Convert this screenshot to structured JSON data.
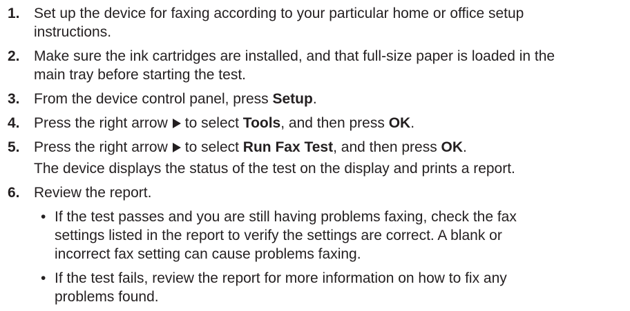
{
  "steps": [
    {
      "number": "1.",
      "lines": [
        "Set up the device for faxing according to your particular home or office setup",
        "instructions."
      ]
    },
    {
      "number": "2.",
      "lines": [
        "Make sure the ink cartridges are installed, and that full-size paper is loaded in the",
        "main tray before starting the test."
      ]
    },
    {
      "number": "3.",
      "pre": "From the device control panel, press ",
      "bold": "Setup",
      "post": "."
    },
    {
      "number": "4.",
      "pre": "Press the right arrow",
      "mid": "to select ",
      "bold": "Tools",
      "mid2": ", and then press ",
      "bold2": "OK",
      "post": "."
    },
    {
      "number": "5.",
      "pre": "Press the right arrow",
      "mid": "to select ",
      "bold": "Run Fax Test",
      "mid2": ", and then press ",
      "bold2": "OK",
      "post": ".",
      "note": "The device displays the status of the test on the display and prints a report."
    },
    {
      "number": "6.",
      "text": "Review the report.",
      "bullets": [
        {
          "symbol": "•",
          "lines": [
            "If the test passes and you are still having problems faxing, check the fax",
            "settings listed in the report to verify the settings are correct. A blank or",
            "incorrect fax setting can cause problems faxing."
          ]
        },
        {
          "symbol": "•",
          "lines": [
            "If the test fails, review the report for more information on how to fix any",
            "problems found."
          ]
        }
      ]
    }
  ],
  "icons": {
    "right_arrow": "right-arrow-icon"
  }
}
